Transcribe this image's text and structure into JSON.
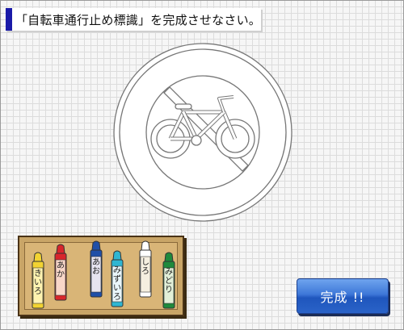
{
  "title": "「自転車通行止め標識」を完成させなさい。",
  "crayons": [
    {
      "label": "きいろ",
      "color": "#f2d332"
    },
    {
      "label": "あか",
      "color": "#d8262b"
    },
    {
      "label": "あお",
      "color": "#1f4fa8"
    },
    {
      "label": "みずいろ",
      "color": "#2fb6d2"
    },
    {
      "label": "しろ",
      "color": "#ffffff"
    },
    {
      "label": "みどり",
      "color": "#1f8a3c"
    }
  ],
  "done_button": "完成 !!"
}
